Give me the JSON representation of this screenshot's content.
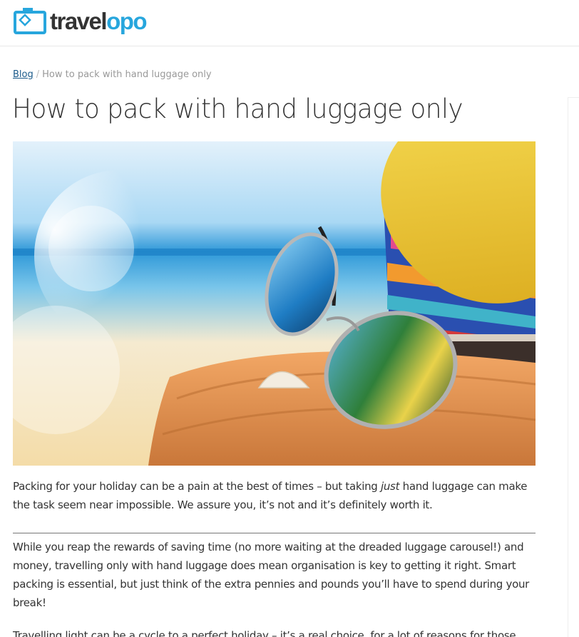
{
  "brand": {
    "logo_text_1": "travel",
    "logo_text_2": "opo",
    "accent_color": "#27a6dd"
  },
  "breadcrumb": {
    "blog_label": "Blog",
    "separator": "/",
    "current": "How to pack with hand luggage only"
  },
  "article": {
    "title": "How to pack with hand luggage only",
    "hero_image": "beach-sunglasses-hat-photo",
    "intro_before": "Packing for your holiday can be a pain at the best of times – but taking ",
    "intro_emphasis": "just",
    "intro_after": " hand luggage can make the task seem near impossible. We assure you, it’s not and it’s definitely worth it.",
    "body_paragraph": "While you reap the rewards of saving time (no more waiting at the dreaded luggage carousel!) and money, travelling only with hand luggage does mean organisation is key to getting it right. Smart packing is essential, but just think of the extra pennies and pounds you’ll have to spend during your break!",
    "next_paragraph_partial": "Travelling light can be a cycle to a perfect holiday – it’s a real choice, for a lot of reasons for those"
  }
}
